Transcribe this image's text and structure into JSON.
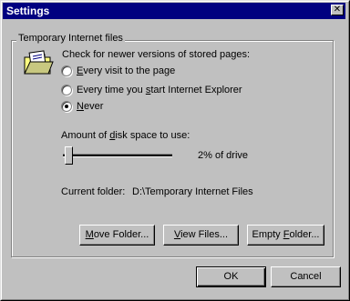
{
  "window": {
    "title": "Settings",
    "close_glyph": "✕"
  },
  "group": {
    "label": "Temporary Internet files",
    "icon": "folder-icon",
    "check_label": "Check for newer versions of stored pages:",
    "options": [
      {
        "pre": "",
        "accel": "E",
        "post": "very visit to the page",
        "checked": false
      },
      {
        "pre": "Every time you ",
        "accel": "s",
        "post": "tart Internet Explorer",
        "checked": false
      },
      {
        "pre": "",
        "accel": "N",
        "post": "ever",
        "checked": true
      }
    ],
    "disk_label_pre": "Amount of ",
    "disk_label_accel": "d",
    "disk_label_post": "isk space to use:",
    "disk_percent": 2,
    "disk_percent_label": "2% of drive",
    "current_folder_label": "Current folder:",
    "current_folder_value": "D:\\Temporary Internet Files"
  },
  "buttons": {
    "move_folder": {
      "accel": "M",
      "post": "ove Folder..."
    },
    "view_files": {
      "accel": "V",
      "post": "iew Files..."
    },
    "empty_folder": {
      "pre": "Empty ",
      "accel": "F",
      "post": "older..."
    },
    "ok": "OK",
    "cancel": "Cancel"
  },
  "colors": {
    "titlebar": "#000080",
    "face": "#c0c0c0",
    "folder_yellow": "#ffff80"
  }
}
